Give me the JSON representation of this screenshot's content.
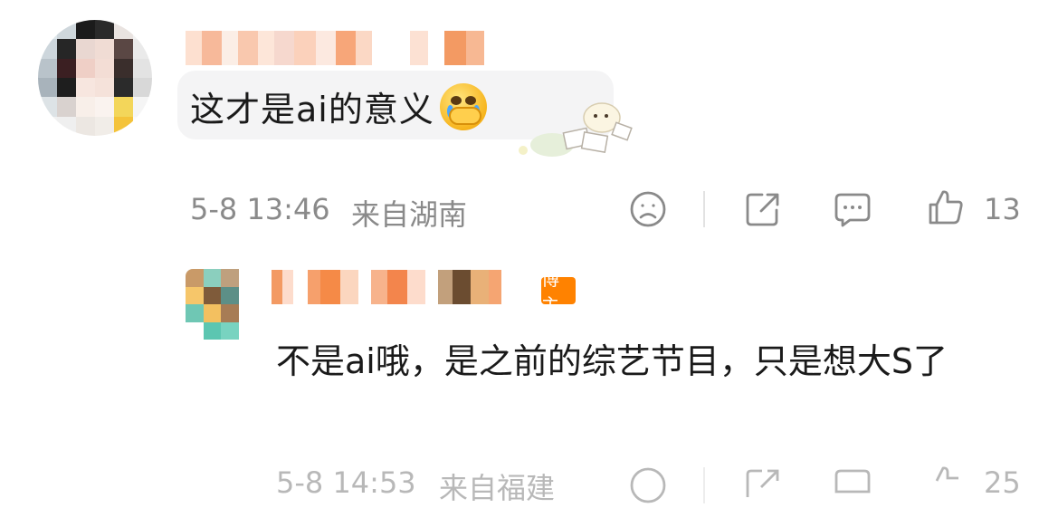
{
  "comment": {
    "text": "这才是ai的意义",
    "timestamp": "5-8 13:46",
    "location": "来自湖南",
    "like_count": "13",
    "emoji_icon": "crying-face-icon",
    "sticker_icon": "envelope-mascot-sticker"
  },
  "reply": {
    "author_badge": "博主",
    "text": "不是ai哦，是之前的综艺节目，只是想大S了",
    "timestamp": "5-8 14:53",
    "location": "来自福建",
    "like_count": "25"
  },
  "colors": {
    "meta_gray": "#8a8a8a",
    "bubble_bg": "#f4f4f5",
    "brand_orange": "#ff8200"
  }
}
